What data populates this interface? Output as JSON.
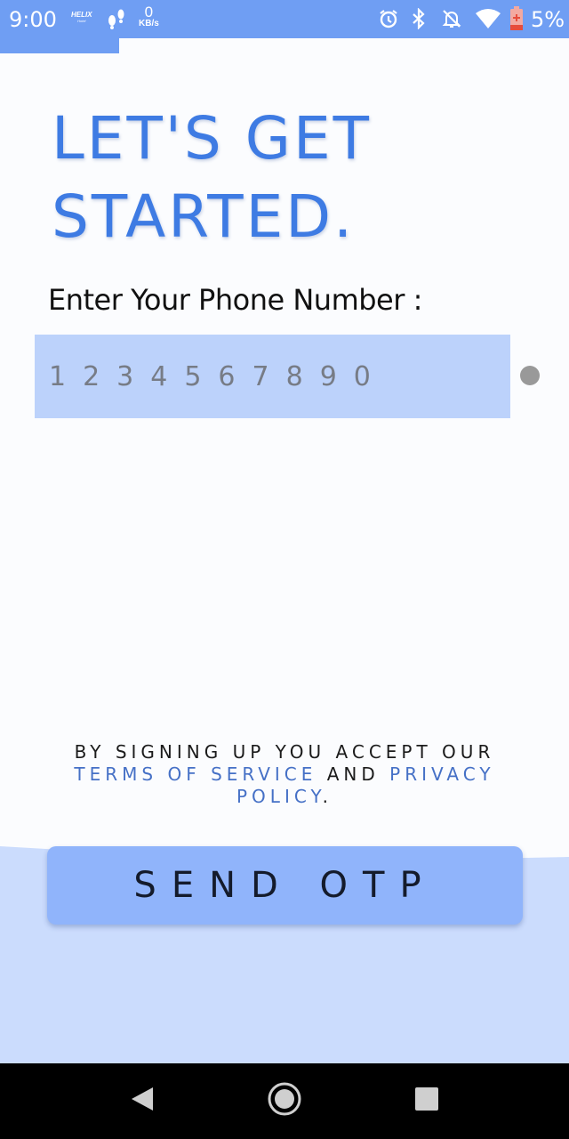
{
  "status_bar": {
    "time": "9:00",
    "carrier_logo": "HELIX",
    "carrier_sub": "Hotel",
    "net_speed_value": "0",
    "net_speed_unit": "KB/s",
    "battery_percent": "5%",
    "icons": [
      "steps-icon",
      "alarm-icon",
      "bluetooth-icon",
      "notifications-off-icon",
      "wifi-icon",
      "battery-low-icon"
    ]
  },
  "headline": {
    "line1": "LET'S GET",
    "line2": "STARTED."
  },
  "phone": {
    "label": "Enter Your Phone Number :",
    "placeholder": "1234567890",
    "value": ""
  },
  "terms": {
    "prefix": "BY SIGNING UP YOU ACCEPT OUR ",
    "tos_link": "TERMS OF SERVICE",
    "middle": " AND ",
    "privacy_link": "PRIVACY POLICY",
    "suffix": "."
  },
  "send_button": {
    "label": "SEND OTP"
  },
  "nav_bar": {
    "icons": [
      "back-icon",
      "home-icon",
      "recents-icon"
    ]
  },
  "colors": {
    "accent": "#6f9ef3",
    "headline": "#3e7be3",
    "input_bg": "#bcd2fb",
    "button_bg": "#90b4fb",
    "bottom_bg": "#cbdcfd",
    "link": "#4570c6"
  }
}
